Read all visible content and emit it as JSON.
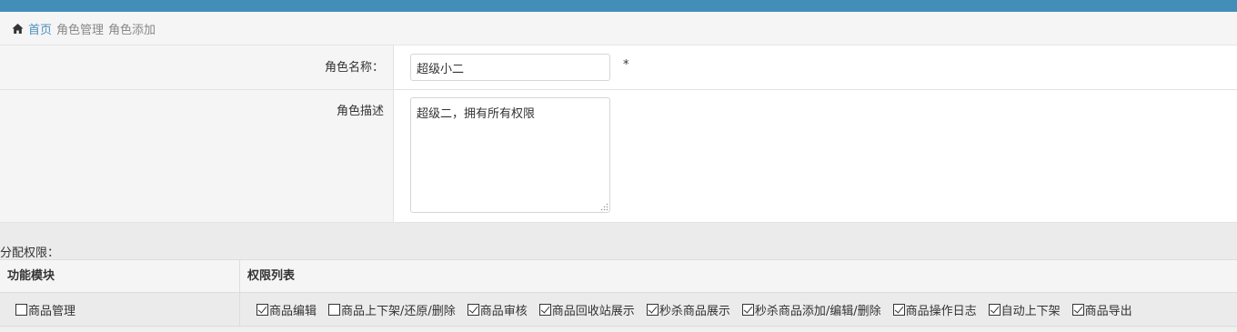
{
  "breadcrumb": {
    "home_icon": "home-icon",
    "home": "首页",
    "items": [
      "角色管理",
      "角色添加"
    ]
  },
  "form": {
    "name_label": "角色名称：",
    "name_value": "超级小二",
    "required_mark": "*",
    "desc_label": "角色描述",
    "desc_value": "超级二，拥有所有权限"
  },
  "permissions": {
    "title": "分配权限：",
    "headers": {
      "module": "功能模块",
      "list": "权限列表"
    },
    "rows": [
      {
        "module": {
          "label": "商品管理",
          "checked": false
        },
        "items": [
          {
            "label": "商品编辑",
            "checked": true
          },
          {
            "label": "商品上下架/还原/删除",
            "checked": false
          },
          {
            "label": "商品审核",
            "checked": true
          },
          {
            "label": "商品回收站展示",
            "checked": true
          },
          {
            "label": "秒杀商品展示",
            "checked": true
          },
          {
            "label": "秒杀商品添加/编辑/删除",
            "checked": true
          },
          {
            "label": "商品操作日志",
            "checked": true
          },
          {
            "label": "自动上下架",
            "checked": true
          },
          {
            "label": "商品导出",
            "checked": true
          }
        ]
      }
    ]
  },
  "colors": {
    "topbar": "#438eb9",
    "link": "#4c8fbd"
  }
}
